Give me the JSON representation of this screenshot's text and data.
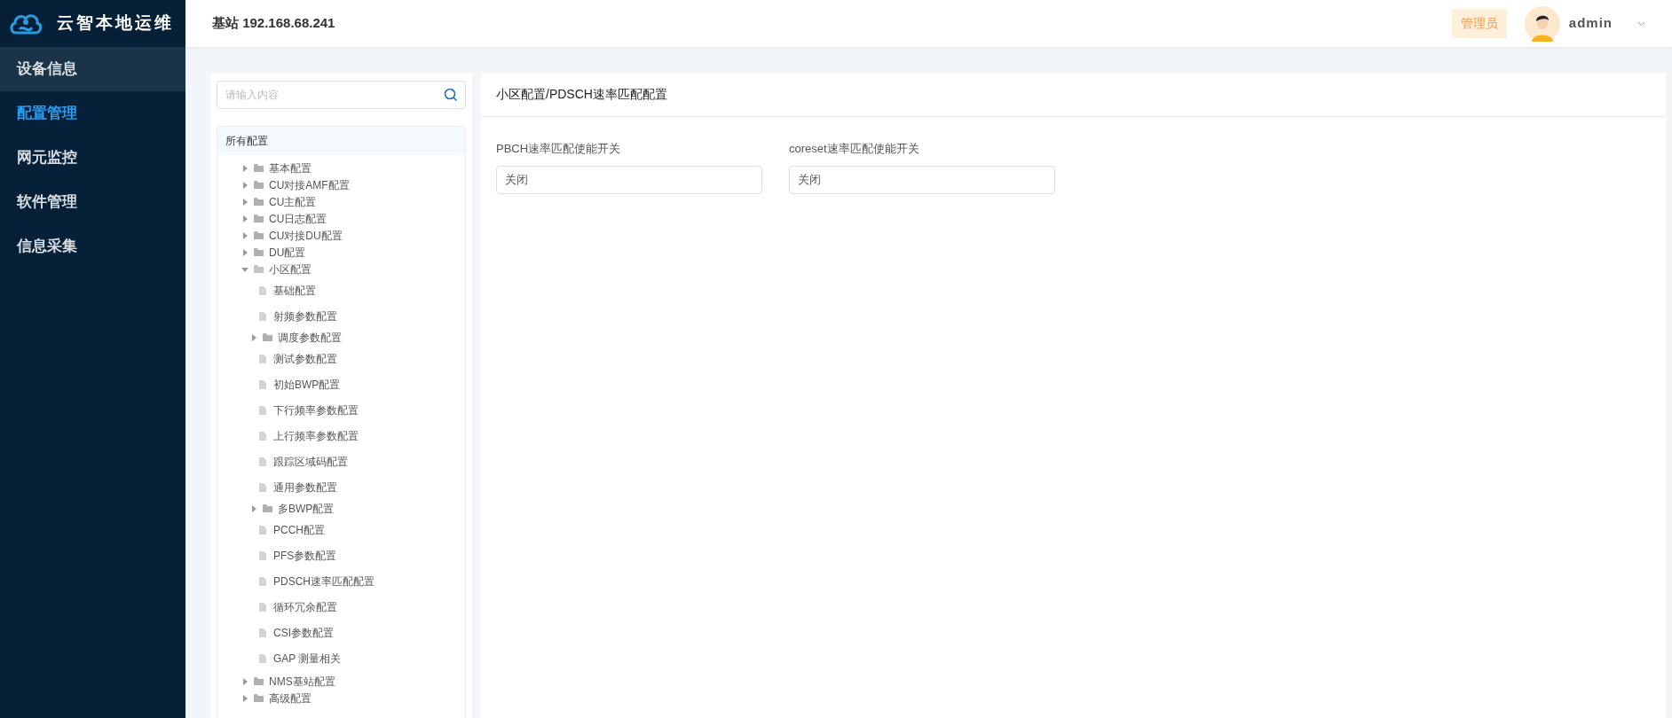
{
  "app": {
    "name": "云智本地运维"
  },
  "sidebar": {
    "items": [
      {
        "label": "设备信息",
        "selected": false,
        "hovered": true
      },
      {
        "label": "配置管理",
        "selected": true,
        "hovered": false
      },
      {
        "label": "网元监控",
        "selected": false,
        "hovered": false
      },
      {
        "label": "软件管理",
        "selected": false,
        "hovered": false
      },
      {
        "label": "信息采集",
        "selected": false,
        "hovered": false
      }
    ]
  },
  "header": {
    "title": "基站 192.168.68.241",
    "role_badge": "管理员",
    "user": "admin"
  },
  "tree": {
    "search": {
      "placeholder": "请输入内容"
    },
    "root": "所有配置",
    "items": [
      {
        "kind": "folder",
        "label": "基本配置",
        "expanded": false
      },
      {
        "kind": "folder",
        "label": "CU对接AMF配置",
        "expanded": false
      },
      {
        "kind": "folder",
        "label": "CU主配置",
        "expanded": false
      },
      {
        "kind": "folder",
        "label": "CU日志配置",
        "expanded": false
      },
      {
        "kind": "folder",
        "label": "CU对接DU配置",
        "expanded": false
      },
      {
        "kind": "folder",
        "label": "DU配置",
        "expanded": false
      },
      {
        "kind": "folder",
        "label": "小区配置",
        "expanded": true,
        "children": [
          {
            "kind": "file",
            "label": "基础配置"
          },
          {
            "kind": "file",
            "label": "射频参数配置"
          },
          {
            "kind": "folder",
            "label": "调度参数配置",
            "expanded": false
          },
          {
            "kind": "file",
            "label": "测试参数配置"
          },
          {
            "kind": "file",
            "label": "初始BWP配置"
          },
          {
            "kind": "file",
            "label": "下行频率参数配置"
          },
          {
            "kind": "file",
            "label": "上行频率参数配置"
          },
          {
            "kind": "file",
            "label": "跟踪区域码配置"
          },
          {
            "kind": "file",
            "label": "通用参数配置"
          },
          {
            "kind": "folder",
            "label": "多BWP配置",
            "expanded": false
          },
          {
            "kind": "file",
            "label": "PCCH配置"
          },
          {
            "kind": "file",
            "label": "PFS参数配置"
          },
          {
            "kind": "file",
            "label": "PDSCH速率匹配配置"
          },
          {
            "kind": "file",
            "label": "循环冗余配置"
          },
          {
            "kind": "file",
            "label": "CSI参数配置"
          },
          {
            "kind": "file",
            "label": "GAP 测量相关"
          }
        ]
      },
      {
        "kind": "folder",
        "label": "NMS基站配置",
        "expanded": false
      },
      {
        "kind": "folder",
        "label": "高级配置",
        "expanded": false
      }
    ]
  },
  "content": {
    "title": "小区配置/PDSCH速率匹配配置",
    "fields": [
      {
        "label": "PBCH速率匹配使能开关",
        "value": "关闭"
      },
      {
        "label": "coreset速率匹配使能开关",
        "value": "关闭"
      }
    ]
  }
}
